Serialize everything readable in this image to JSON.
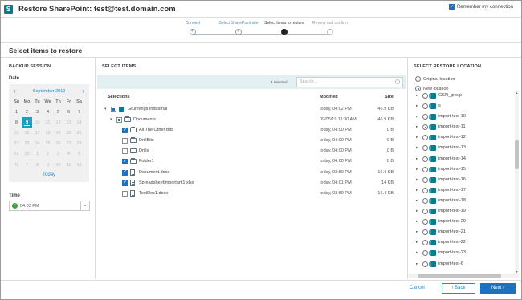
{
  "title": "Restore SharePoint: test@test.domain.com",
  "remember": {
    "label": "Remember my connection",
    "checked": true
  },
  "steps": [
    {
      "label": "Connect",
      "state": "done"
    },
    {
      "label": "Select SharePoint site",
      "state": "done"
    },
    {
      "label": "Select items to restore",
      "state": "current"
    },
    {
      "label": "Review and confirm",
      "state": "future"
    }
  ],
  "page_title": "Select items to restore",
  "backup": {
    "heading": "BACKUP SESSION",
    "date_label": "Date",
    "month": "September 2019",
    "weekdays": [
      "Su",
      "Mo",
      "Tu",
      "We",
      "Th",
      "Fr",
      "Sa"
    ],
    "calendar_rows": [
      [
        "1",
        "2",
        "3",
        "4",
        "5",
        "6",
        "7"
      ],
      [
        "8",
        "9",
        "10",
        "11",
        "12",
        "13",
        "14"
      ],
      [
        "15",
        "16",
        "17",
        "18",
        "19",
        "20",
        "21"
      ],
      [
        "22",
        "23",
        "24",
        "25",
        "26",
        "27",
        "28"
      ],
      [
        "29",
        "30",
        "1",
        "2",
        "3",
        "4",
        "5"
      ],
      [
        "6",
        "7",
        "8",
        "9",
        "10",
        "11",
        "12"
      ]
    ],
    "today_label": "Today",
    "time_label": "Time",
    "time_value": "04:03 PM",
    "colors": {
      "selected_day": "#14a1c5",
      "accent": "#2d86c6"
    }
  },
  "items": {
    "heading": "SELECT ITEMS",
    "selected_count": "4 selected",
    "search_placeholder": "Search...",
    "columns": {
      "name": "Selections",
      "modified": "Modified",
      "size": "Size"
    },
    "rows": [
      {
        "name": "Grunnings Industrial",
        "modified": "today, 04:02 PM",
        "size": "46.9 KB",
        "level": 0,
        "expander": "▾",
        "check": "partial",
        "icon": "site-icon"
      },
      {
        "name": "Documents",
        "modified": "09/05/19 11:30 AM",
        "size": "46.9 KB",
        "level": 1,
        "expander": "▾",
        "check": "partial",
        "icon": "folder-icon"
      },
      {
        "name": "All The Other Bits",
        "modified": "today, 04:00 PM",
        "size": "0 B",
        "level": 2,
        "check": "checked",
        "icon": "folder-icon"
      },
      {
        "name": "DrillBits",
        "modified": "today, 04:00 PM",
        "size": "0 B",
        "level": 2,
        "check": "unchecked",
        "icon": "folder-icon"
      },
      {
        "name": "Drills",
        "modified": "today, 04:00 PM",
        "size": "0 B",
        "level": 2,
        "check": "unchecked",
        "icon": "folder-icon"
      },
      {
        "name": "Folder1",
        "modified": "today, 04:00 PM",
        "size": "0 B",
        "level": 2,
        "check": "checked",
        "icon": "folder-icon"
      },
      {
        "name": "Document.docx",
        "modified": "today, 03:59 PM",
        "size": "16.4 KB",
        "level": 2,
        "check": "checked",
        "icon": "document-icon"
      },
      {
        "name": "SpreadsheetImportant1.xlsx",
        "modified": "today, 04:01 PM",
        "size": "14 KB",
        "level": 2,
        "check": "checked",
        "icon": "document-icon"
      },
      {
        "name": "TestDoc1.docx",
        "modified": "today, 03:59 PM",
        "size": "16.4 KB",
        "level": 2,
        "check": "unchecked",
        "icon": "document-icon"
      }
    ]
  },
  "location": {
    "heading": "SELECT RESTORE LOCATION",
    "original_label": "Original location",
    "new_label": "New location",
    "new_selected": true,
    "sites": [
      {
        "label": "GSN_group",
        "selected": false
      },
      {
        "label": "s",
        "selected": false
      },
      {
        "label": "import-test-10",
        "selected": false
      },
      {
        "label": "import-test-11",
        "selected": true
      },
      {
        "label": "import-test-12",
        "selected": false
      },
      {
        "label": "import-test-13",
        "selected": false
      },
      {
        "label": "import-test-14",
        "selected": false
      },
      {
        "label": "import-test-15",
        "selected": false
      },
      {
        "label": "import-test-16",
        "selected": false
      },
      {
        "label": "import-test-17",
        "selected": false
      },
      {
        "label": "import-test-18",
        "selected": false
      },
      {
        "label": "import-test-19",
        "selected": false
      },
      {
        "label": "import-test-20",
        "selected": false
      },
      {
        "label": "import-test-21",
        "selected": false
      },
      {
        "label": "import-test-22",
        "selected": false
      },
      {
        "label": "import-test-23",
        "selected": false
      },
      {
        "label": "import-test-6",
        "selected": false
      }
    ]
  },
  "footer": {
    "cancel": "Cancel",
    "back": "Back",
    "next": "Next"
  },
  "colors": {
    "primary": "#1b72be",
    "toolbar_bg": "#e2f0f2",
    "brand": "#0b7a8c"
  }
}
